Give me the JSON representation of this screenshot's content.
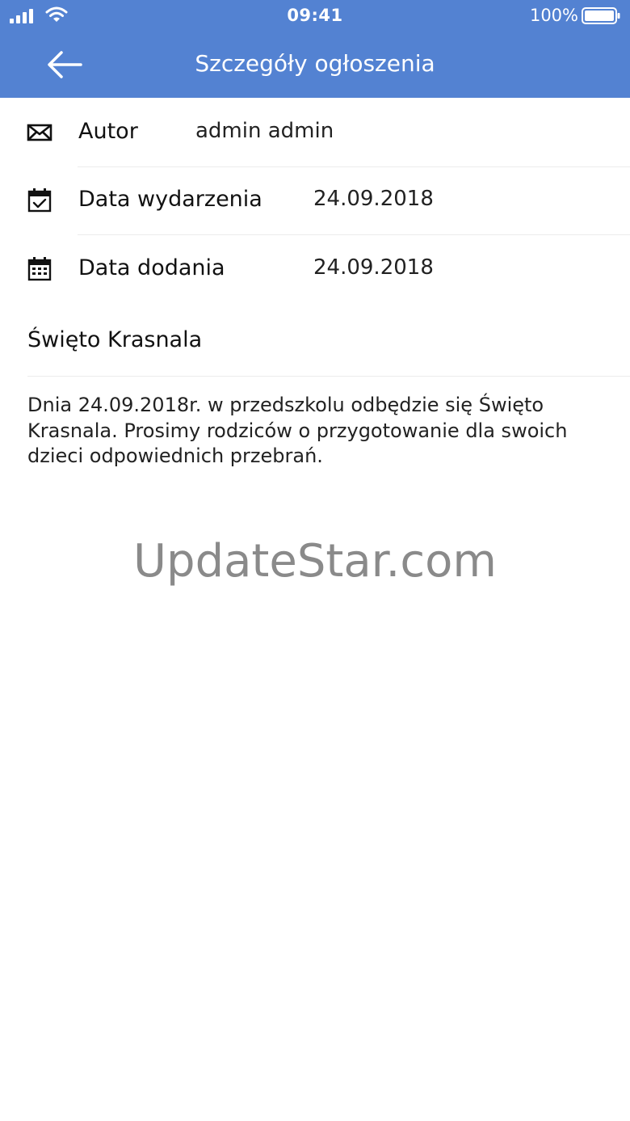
{
  "status_bar": {
    "time": "09:41",
    "battery_percent": "100%"
  },
  "header": {
    "title": "Szczegóły ogłoszenia",
    "back_icon": "arrow-left-icon",
    "background_color": "#5382d2"
  },
  "details": [
    {
      "icon": "envelope-icon",
      "label": "Autor",
      "value": "admin admin"
    },
    {
      "icon": "calendar-check-icon",
      "label": "Data wydarzenia",
      "value": "24.09.2018"
    },
    {
      "icon": "calendar-icon",
      "label": "Data dodania",
      "value": "24.09.2018"
    }
  ],
  "announcement": {
    "title": "Święto Krasnala",
    "body": "Dnia 24.09.2018r. w przedszkolu odbędzie się Święto Krasnala. Prosimy rodziców o przygotowanie dla swoich dzieci odpowiednich przebrań."
  },
  "watermark": "UpdateStar.com"
}
